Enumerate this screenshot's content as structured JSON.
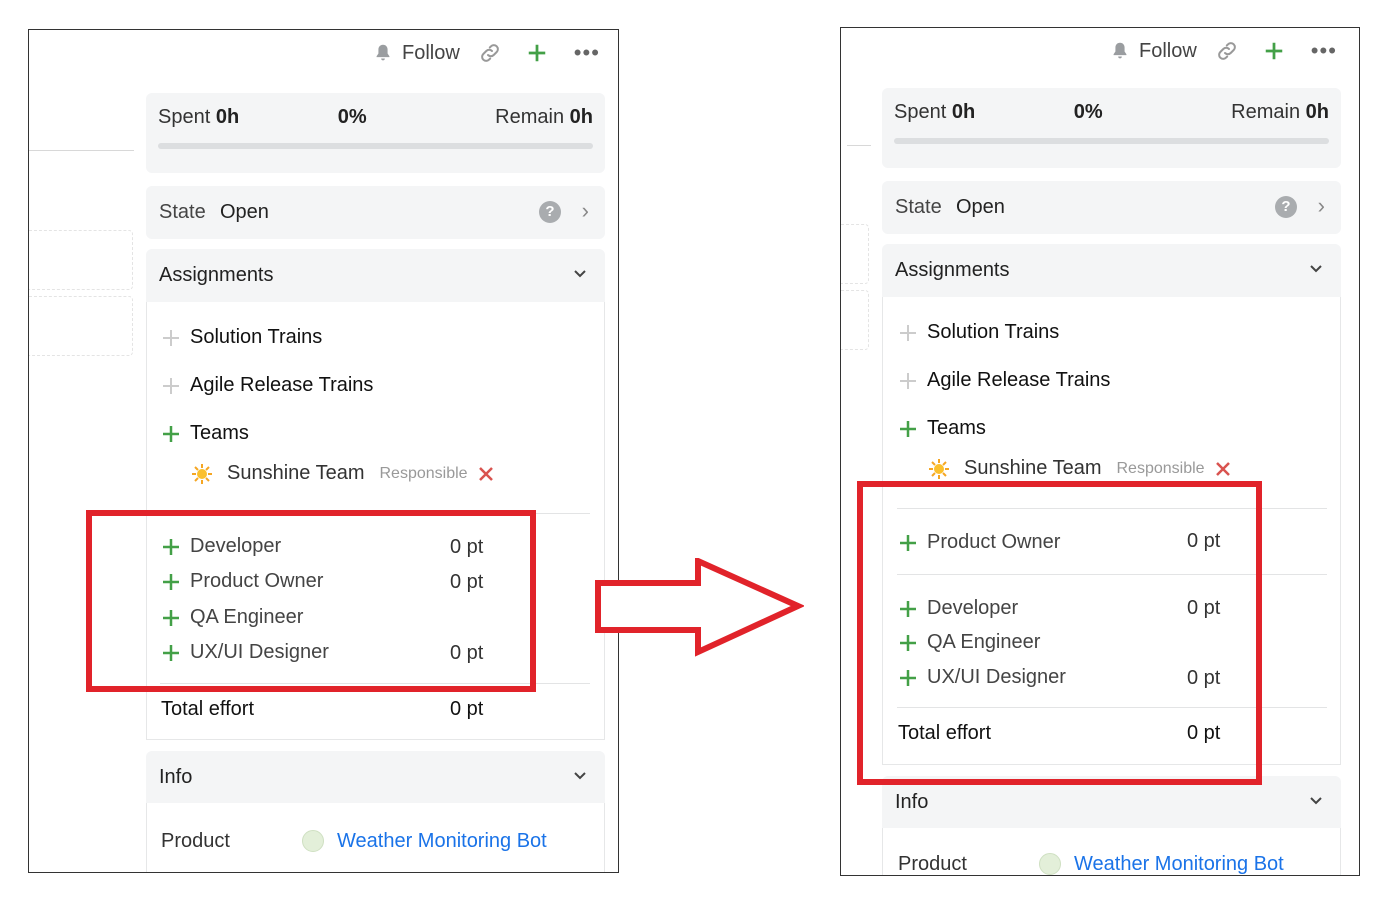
{
  "toolbar": {
    "follow_label": "Follow"
  },
  "summary": {
    "spent_label": "Spent",
    "spent_value": "0h",
    "percent": "0%",
    "remain_label": "Remain",
    "remain_value": "0h",
    "progress": 0
  },
  "state": {
    "label": "State",
    "value": "Open",
    "help": "?"
  },
  "assignments": {
    "title": "Assignments",
    "groups": [
      "Solution Trains",
      "Agile Release Trains",
      "Teams"
    ],
    "team": {
      "name": "Sunshine Team",
      "role": "Responsible"
    }
  },
  "before": {
    "roles": [
      {
        "name": "Developer",
        "pts": "0 pt"
      },
      {
        "name": "Product Owner",
        "pts": "0 pt"
      },
      {
        "name": "QA Engineer",
        "pts": ""
      },
      {
        "name": "UX/UI Designer",
        "pts": "0 pt"
      }
    ]
  },
  "after": {
    "primary_role": {
      "name": "Product Owner",
      "pts": "0 pt"
    },
    "roles": [
      {
        "name": "Developer",
        "pts": "0 pt"
      },
      {
        "name": "QA Engineer",
        "pts": ""
      },
      {
        "name": "UX/UI Designer",
        "pts": "0 pt"
      }
    ]
  },
  "total": {
    "label": "Total effort",
    "value": "0 pt"
  },
  "info": {
    "title": "Info",
    "product_label": "Product",
    "product_value": "Weather Monitoring Bot"
  },
  "colors": {
    "accent_green": "#43a047",
    "highlight_red": "#e1232a",
    "link_blue": "#1a73e8",
    "remove_red": "#d9534f"
  }
}
